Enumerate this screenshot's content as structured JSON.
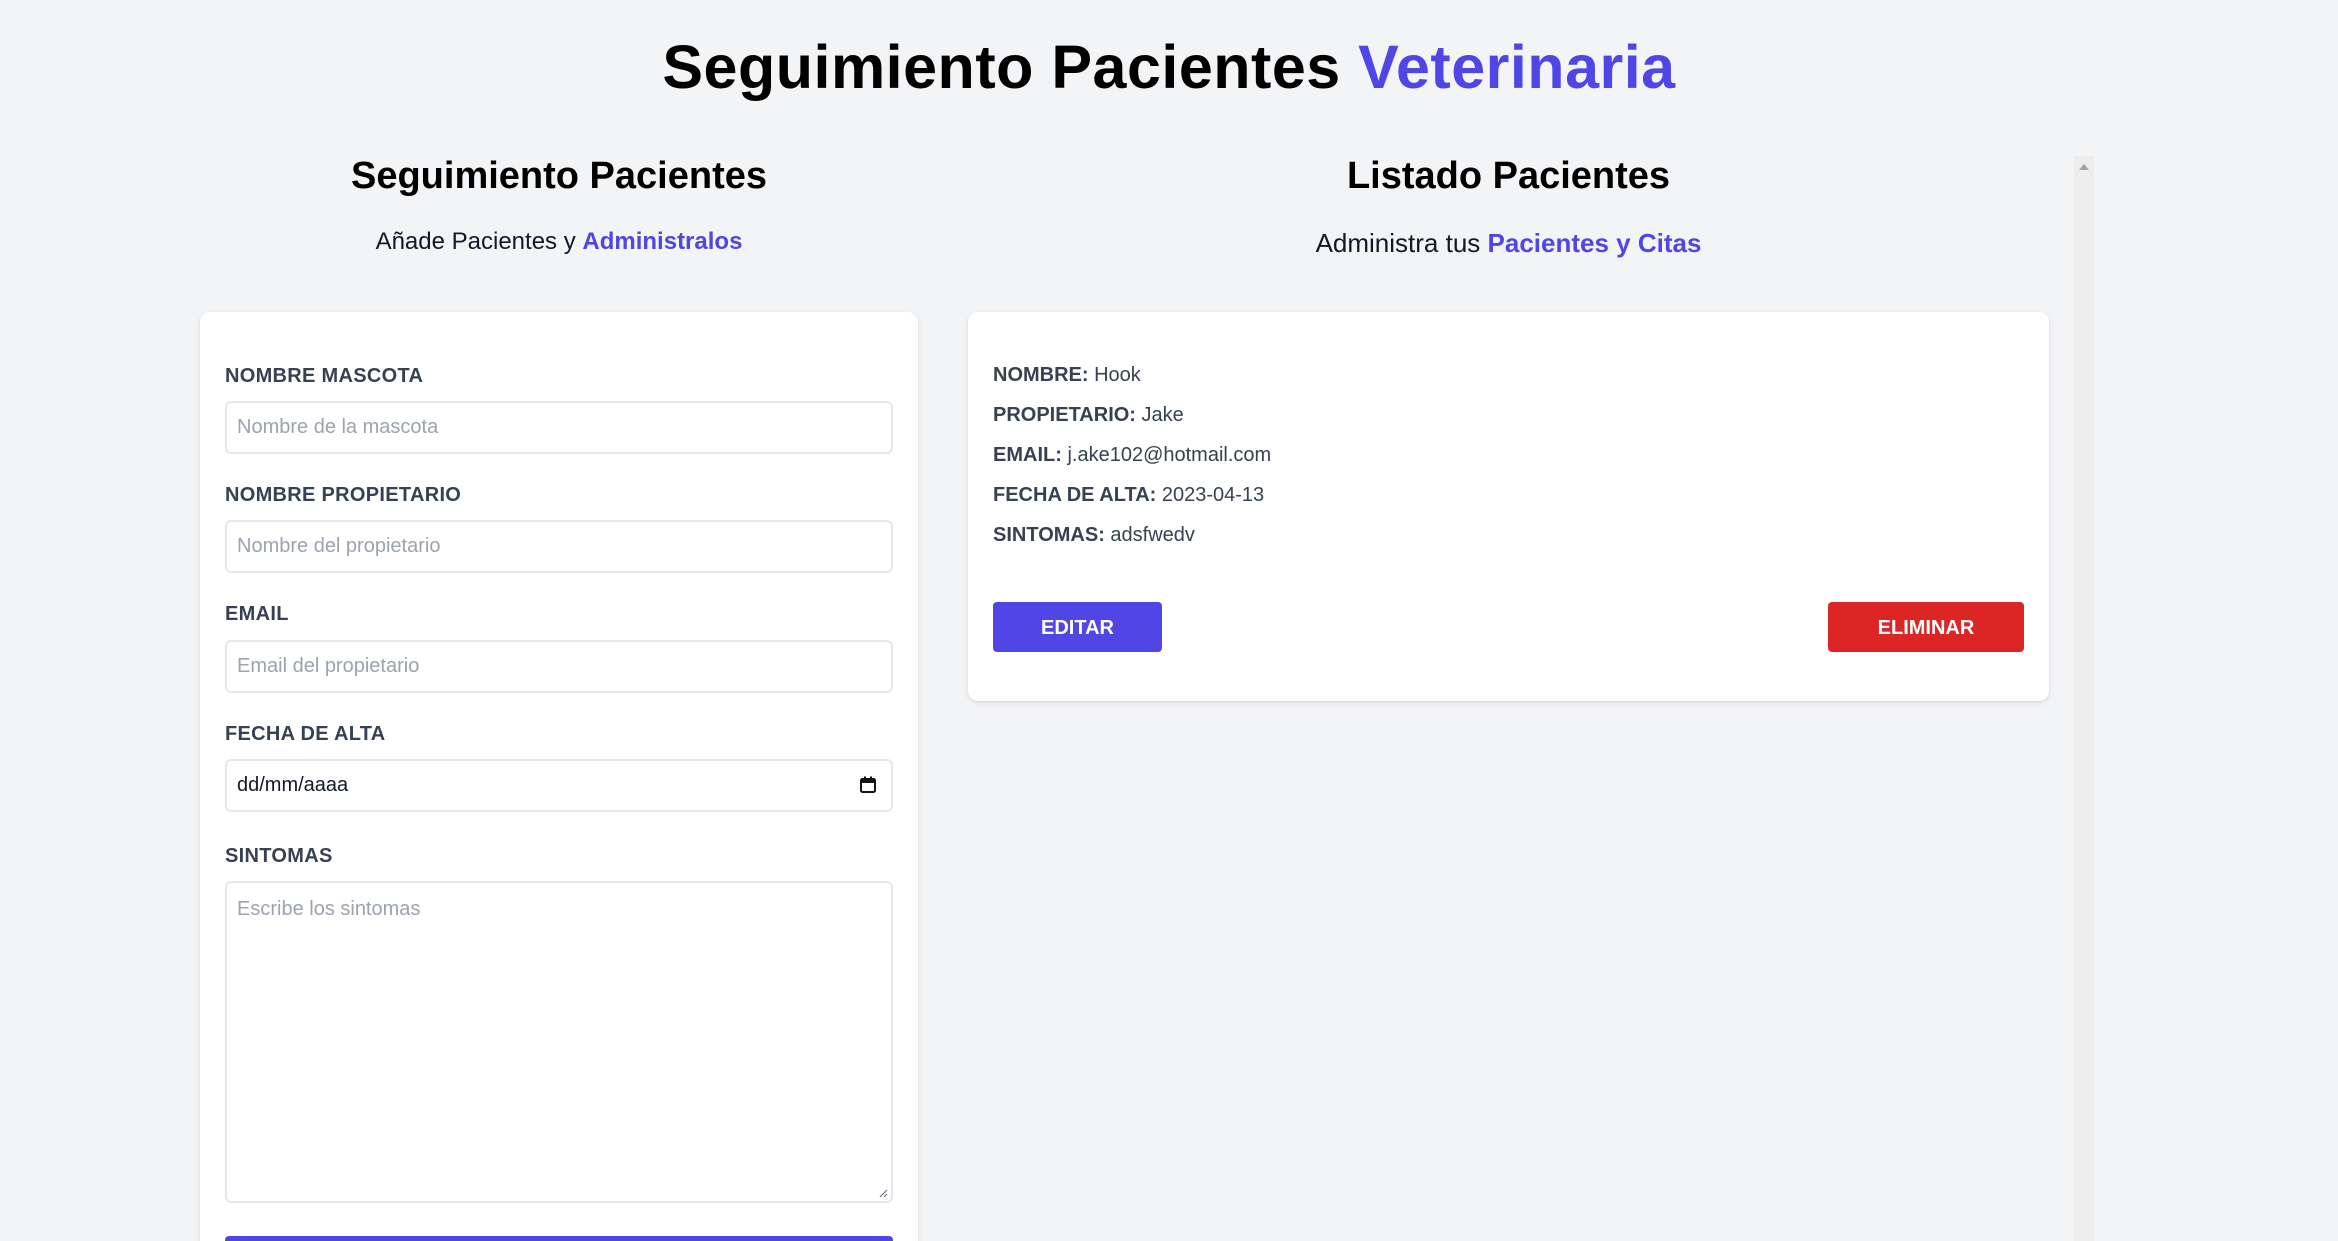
{
  "header": {
    "title_main": "Seguimiento Pacientes",
    "title_accent": "Veterinaria",
    "accent_color": "#4f46e5"
  },
  "form_section": {
    "title": "Seguimiento Pacientes",
    "subtitle_prefix": "Añade Pacientes y",
    "subtitle_accent": "Administralos",
    "fields": {
      "pet_name": {
        "label": "NOMBRE MASCOTA",
        "placeholder": "Nombre de la mascota",
        "value": ""
      },
      "owner_name": {
        "label": "NOMBRE PROPIETARIO",
        "placeholder": "Nombre del propietario",
        "value": ""
      },
      "email": {
        "label": "EMAIL",
        "placeholder": "Email del propietario",
        "value": ""
      },
      "date": {
        "label": "FECHA DE ALTA",
        "value": "dd/mm/aaaa",
        "icon": "calendar-icon"
      },
      "symptoms": {
        "label": "SINTOMAS",
        "placeholder": "Escribe los sintomas",
        "value": ""
      }
    },
    "submit_color": "#4f46e5"
  },
  "list_section": {
    "title": "Listado Pacientes",
    "subtitle_prefix": "Administra tus",
    "subtitle_accent": "Pacientes y Citas",
    "patients": [
      {
        "name_label": "NOMBRE:",
        "name": "Hook",
        "owner_label": "PROPIETARIO:",
        "owner": "Jake",
        "email_label": "EMAIL:",
        "email": "j.ake102@hotmail.com",
        "date_label": "FECHA DE ALTA:",
        "date": "2023-04-13",
        "symptoms_label": "SINTOMAS:",
        "symptoms": "adsfwedv",
        "edit_label": "EDITAR",
        "delete_label": "ELIMINAR",
        "edit_color": "#4f46e5",
        "delete_color": "#dc2626"
      }
    ]
  }
}
